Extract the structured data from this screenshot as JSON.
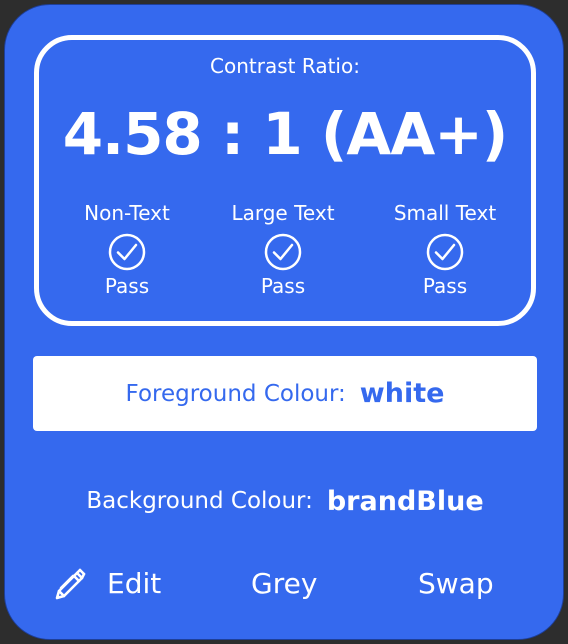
{
  "contrast": {
    "label": "Contrast Ratio:",
    "value": "4.58 : 1  (AA+)"
  },
  "checks": [
    {
      "title": "Non-Text",
      "status": "Pass",
      "icon": "check-circle-icon"
    },
    {
      "title": "Large Text",
      "status": "Pass",
      "icon": "check-circle-icon"
    },
    {
      "title": "Small Text",
      "status": "Pass",
      "icon": "check-circle-icon"
    }
  ],
  "foreground": {
    "label": "Foreground Colour:",
    "value": "white"
  },
  "background": {
    "label": "Background Colour:",
    "value": "brandBlue"
  },
  "actions": {
    "edit_label": "Edit",
    "edit_icon": "pencil-icon",
    "grey_label": "Grey",
    "swap_label": "Swap"
  },
  "colors": {
    "brand_blue": "#3569ee",
    "white": "#ffffff",
    "page_background": "#2d2d2d"
  }
}
